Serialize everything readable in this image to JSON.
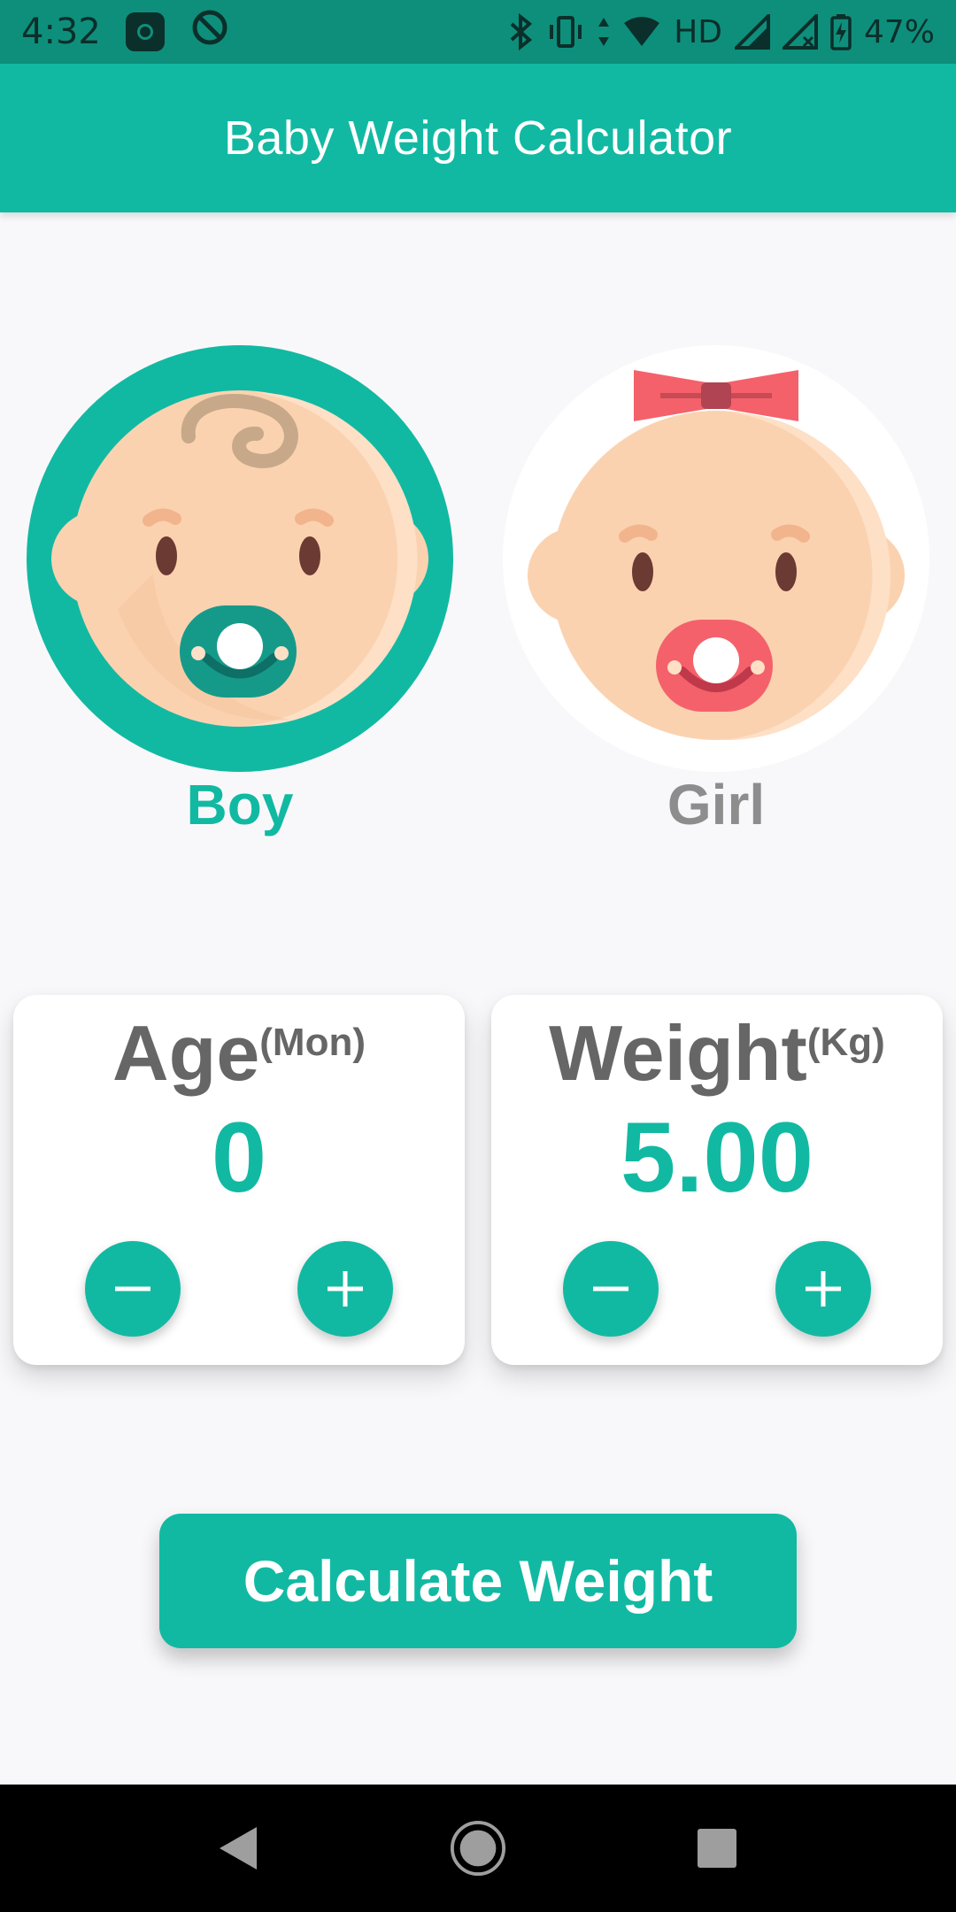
{
  "status_bar": {
    "time": "4:32",
    "network": "HD",
    "battery": "47%",
    "icons": [
      "mi-icon",
      "sync-off-icon",
      "bluetooth-icon",
      "vibrate-icon",
      "data-arrows-icon",
      "wifi-icon",
      "signal-icon",
      "signal-no-icon",
      "battery-charging-icon"
    ]
  },
  "app_bar": {
    "title": "Baby Weight Calculator"
  },
  "gender": {
    "boy_label": "Boy",
    "girl_label": "Girl",
    "selected": "boy"
  },
  "age_card": {
    "title": "Age",
    "unit": "(Mon)",
    "value": "0"
  },
  "weight_card": {
    "title": "Weight",
    "unit": "(Kg)",
    "value": "5.00"
  },
  "actions": {
    "calculate_label": "Calculate Weight"
  },
  "colors": {
    "accent": "#12b9a2",
    "status_bar": "#0e8f7c",
    "muted_text": "#8d8d8d",
    "card_title": "#666666",
    "girl_bow": "#f4616b"
  },
  "nav_bar": {
    "icons": [
      "back-icon",
      "home-icon",
      "recent-apps-icon"
    ]
  }
}
